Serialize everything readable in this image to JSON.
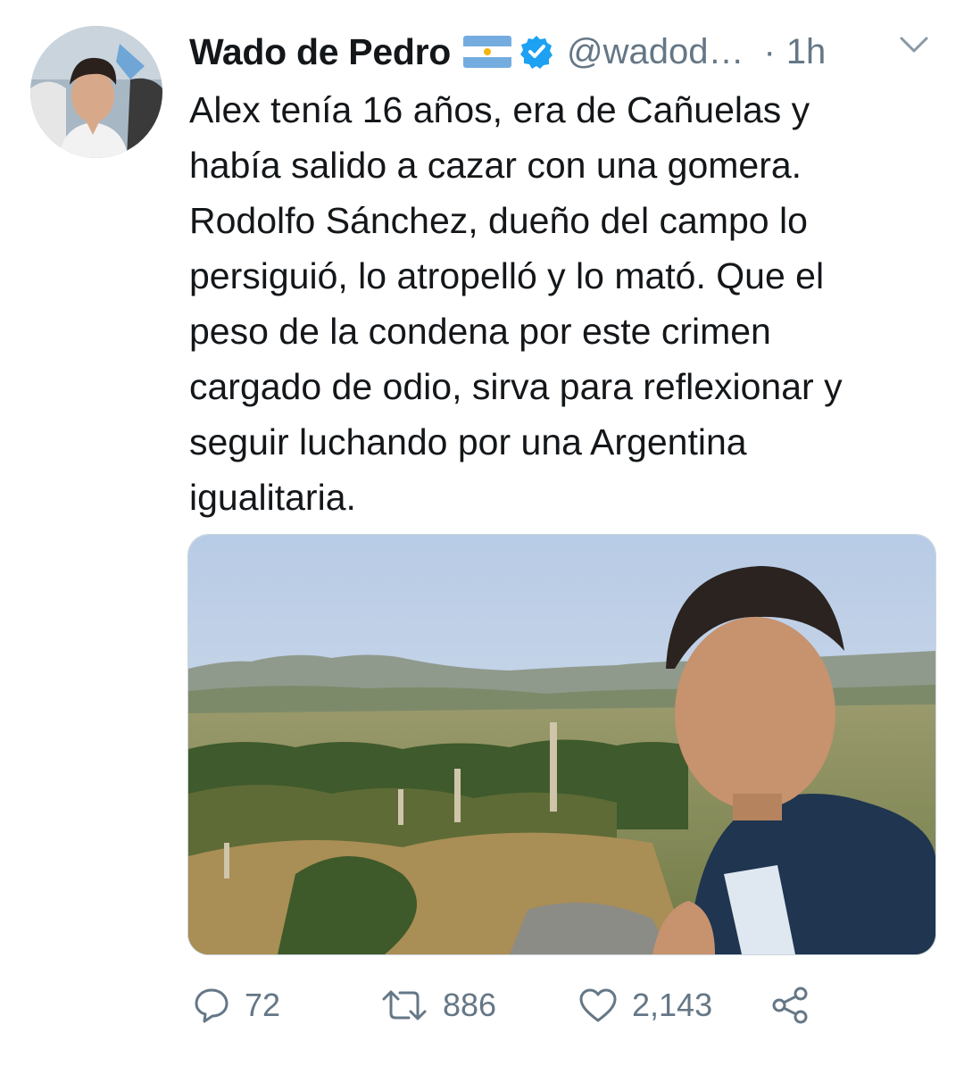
{
  "tweet": {
    "author": {
      "display_name": "Wado de Pedro",
      "handle": "@wadod…",
      "flag_icon": "argentina-flag-icon",
      "verified_icon": "verified-badge-icon",
      "avatar_icon": "avatar-photo"
    },
    "separator": "·",
    "time": "1h",
    "menu_icon": "chevron-down-icon",
    "text": "Alex tenía 16 años, era de Cañuelas y\nhabía salido a cazar con una gomera.\nRodolfo Sánchez, dueño del campo lo\npersiguió, lo atropelló y lo mató. Que el\npeso de la condena por este crimen\ncargado de odio, sirva para reflexionar y\nseguir luchando por una Argentina\nigualitaria.",
    "media": {
      "icon": "photo-selfie-countryside"
    },
    "actions": {
      "reply": {
        "icon": "reply-icon",
        "count": "72"
      },
      "retweet": {
        "icon": "retweet-icon",
        "count": "886"
      },
      "like": {
        "icon": "heart-icon",
        "count": "2,143"
      },
      "share": {
        "icon": "share-icon"
      }
    }
  },
  "colors": {
    "text": "#14171a",
    "secondary": "#657786",
    "verified": "#1da1f2",
    "flag_blue": "#74acdf"
  }
}
